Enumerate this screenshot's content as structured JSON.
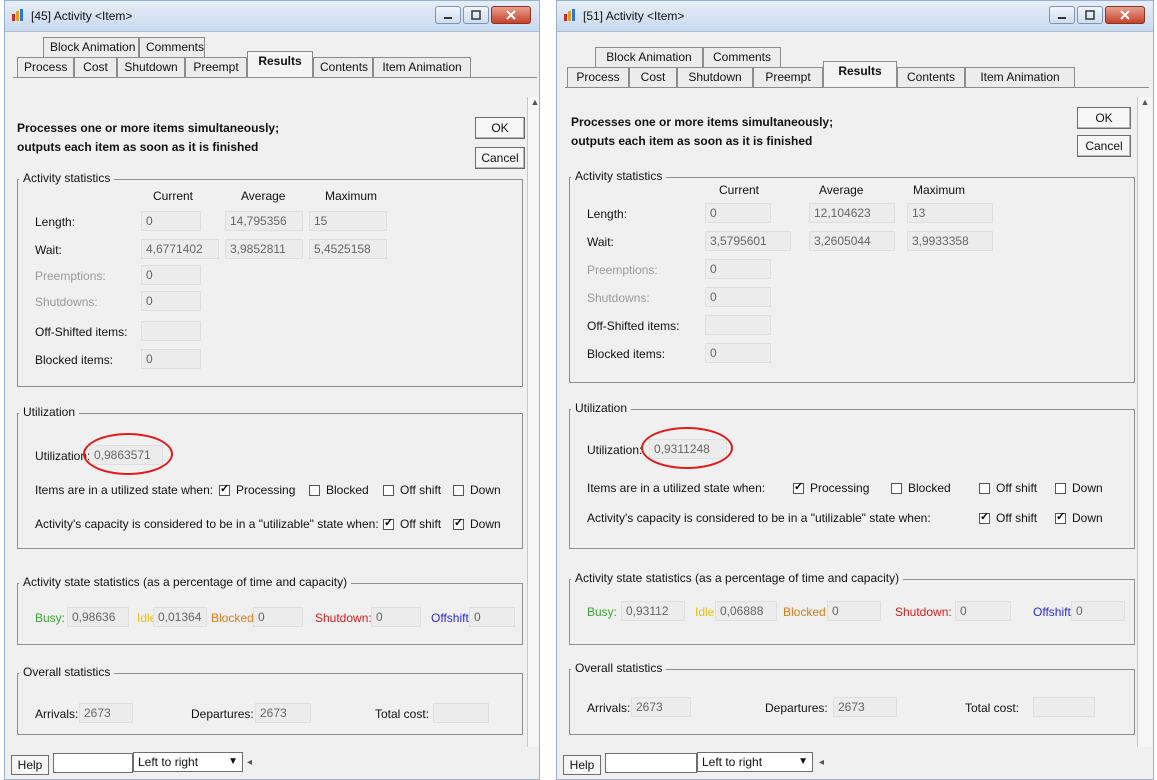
{
  "windows": [
    {
      "title": "[45]  Activity  <Item>",
      "tabs_row1": [
        "Block Animation",
        "Comments"
      ],
      "tabs_row2": [
        "Process",
        "Cost",
        "Shutdown",
        "Preempt",
        "Results",
        "Contents",
        "Item Animation"
      ],
      "active_tab": "Results",
      "description_line1": "Processes one or more items simultaneously;",
      "description_line2": "outputs each item as soon as it is finished",
      "ok_label": "OK",
      "cancel_label": "Cancel",
      "activity_statistics": {
        "legend": "Activity statistics",
        "col_current": "Current",
        "col_average": "Average",
        "col_maximum": "Maximum",
        "length_label": "Length:",
        "length_current": "0",
        "length_average": "14,795356",
        "length_maximum": "15",
        "wait_label": "Wait:",
        "wait_current": "4,6771402",
        "wait_average": "3,9852811",
        "wait_maximum": "5,4525158",
        "preemptions_label": "Preemptions:",
        "preemptions_value": "0",
        "shutdowns_label": "Shutdowns:",
        "shutdowns_value": "0",
        "offshifted_label": "Off-Shifted items:",
        "offshifted_value": "",
        "blocked_label": "Blocked items:",
        "blocked_value": "0"
      },
      "utilization": {
        "legend": "Utilization",
        "label": "Utilization:",
        "value": "0,9863571",
        "utilized_state_label": "Items are in a utilized state when:",
        "processing": "Processing",
        "blocked": "Blocked",
        "offshift": "Off shift",
        "down": "Down",
        "capacity_label": "Activity's capacity is considered to be in a \"utilizable\" state when:",
        "cap_offshift": "Off shift",
        "cap_down": "Down"
      },
      "state_statistics": {
        "legend": "Activity state statistics (as a percentage of time and capacity)",
        "busy_label": "Busy:",
        "busy_value": "0,98636",
        "idle_label": "Idle:",
        "idle_value": "0,01364",
        "blocked_label": "Blocked:",
        "blocked_value": "0",
        "shutdown_label": "Shutdown:",
        "shutdown_value": "0",
        "offshift_label": "Offshift:",
        "offshift_value": "0"
      },
      "overall_statistics": {
        "legend": "Overall statistics",
        "arrivals_label": "Arrivals:",
        "arrivals_value": "2673",
        "departures_label": "Departures:",
        "departures_value": "2673",
        "total_cost_label": "Total cost:",
        "total_cost_value": ""
      },
      "status": {
        "help_label": "Help",
        "direction": "Left to right"
      }
    },
    {
      "title": "[51]  Activity  <Item>",
      "tabs_row1": [
        "Block Animation",
        "Comments"
      ],
      "tabs_row2": [
        "Process",
        "Cost",
        "Shutdown",
        "Preempt",
        "Results",
        "Contents",
        "Item Animation"
      ],
      "active_tab": "Results",
      "description_line1": "Processes one or more items simultaneously;",
      "description_line2": "outputs each item as soon as it is finished",
      "ok_label": "OK",
      "cancel_label": "Cancel",
      "activity_statistics": {
        "legend": "Activity statistics",
        "col_current": "Current",
        "col_average": "Average",
        "col_maximum": "Maximum",
        "length_label": "Length:",
        "length_current": "0",
        "length_average": "12,104623",
        "length_maximum": "13",
        "wait_label": "Wait:",
        "wait_current": "3,5795601",
        "wait_average": "3,2605044",
        "wait_maximum": "3,9933358",
        "preemptions_label": "Preemptions:",
        "preemptions_value": "0",
        "shutdowns_label": "Shutdowns:",
        "shutdowns_value": "0",
        "offshifted_label": "Off-Shifted items:",
        "offshifted_value": "",
        "blocked_label": "Blocked items:",
        "blocked_value": "0"
      },
      "utilization": {
        "legend": "Utilization",
        "label": "Utilization:",
        "value": "0,9311248",
        "utilized_state_label": "Items are in a utilized state when:",
        "processing": "Processing",
        "blocked": "Blocked",
        "offshift": "Off shift",
        "down": "Down",
        "capacity_label": "Activity's capacity is considered to be in a \"utilizable\" state when:",
        "cap_offshift": "Off shift",
        "cap_down": "Down"
      },
      "state_statistics": {
        "legend": "Activity state statistics (as a percentage of time and capacity)",
        "busy_label": "Busy:",
        "busy_value": "0,93112",
        "idle_label": "Idle:",
        "idle_value": "0,06888",
        "blocked_label": "Blocked:",
        "blocked_value": "0",
        "shutdown_label": "Shutdown:",
        "shutdown_value": "0",
        "offshift_label": "Offshift:",
        "offshift_value": "0"
      },
      "overall_statistics": {
        "legend": "Overall statistics",
        "arrivals_label": "Arrivals:",
        "arrivals_value": "2673",
        "departures_label": "Departures:",
        "departures_value": "2673",
        "total_cost_label": "Total cost:",
        "total_cost_value": ""
      },
      "status": {
        "help_label": "Help",
        "direction": "Left to right"
      }
    }
  ],
  "colors": {
    "busy": "#3aa635",
    "idle": "#e8c21a",
    "blocked": "#e07b1a",
    "shutdown": "#d42020",
    "offshift": "#2a2ad6",
    "highlight_circle": "#e01b1b"
  },
  "icons": [
    "app-icon",
    "minimize-icon",
    "maximize-icon",
    "close-icon",
    "checkbox-checked-icon",
    "checkbox-unchecked-icon",
    "dropdown-arrow-icon",
    "scroll-up-arrow-icon"
  ]
}
